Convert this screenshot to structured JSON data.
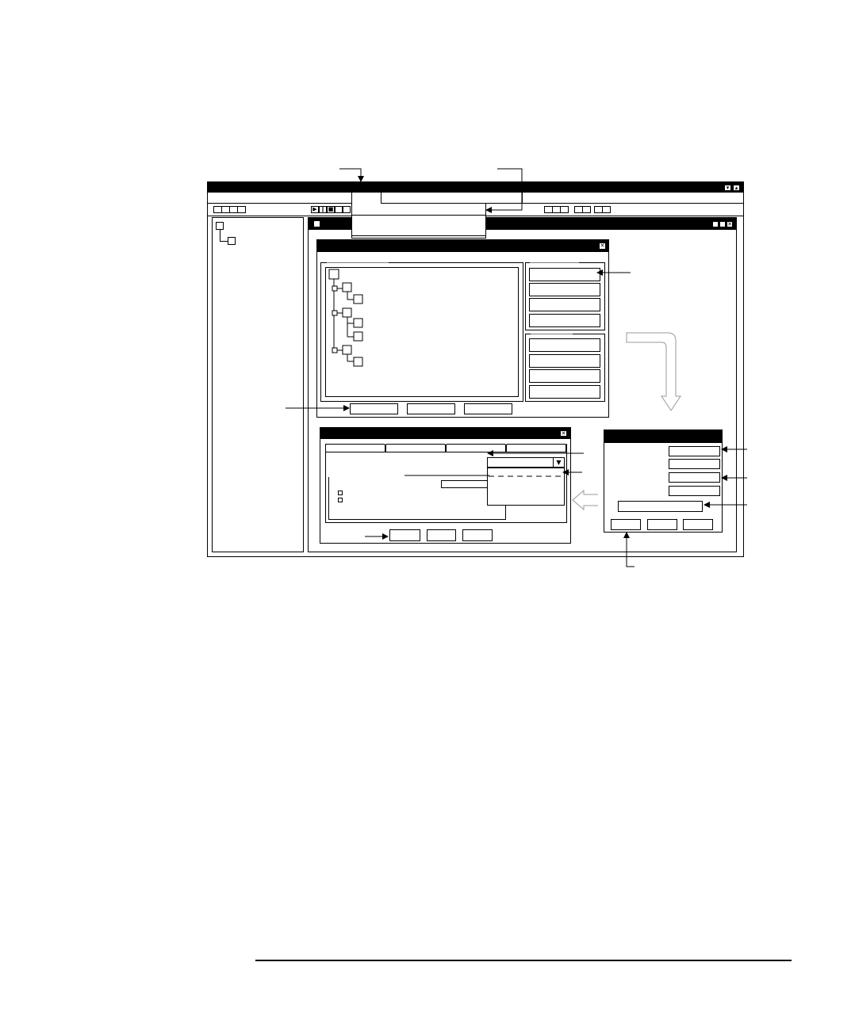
{
  "diagram": {
    "annotations": [],
    "colors": {
      "line": "#000000",
      "background": "#ffffff",
      "flow_arrow": "#9a9a9a"
    }
  },
  "main_window": {
    "title": "",
    "title_controls": [
      "minimize-icon",
      "maximize-icon"
    ],
    "menu_items": [],
    "toolbar_groups": [
      {
        "icons": [
          "toolbar-button",
          "toolbar-button",
          "toolbar-button"
        ]
      },
      {
        "icons": [
          "play-icon",
          "pause-icon",
          "stop-icon",
          "toolbar-button",
          "toolbar-button"
        ]
      },
      {
        "icons": [
          "toolbar-button",
          "toolbar-button",
          "toolbar-button"
        ]
      },
      {
        "icons": [
          "toolbar-button",
          "toolbar-button"
        ]
      },
      {
        "icons": [
          "toolbar-button",
          "toolbar-button"
        ]
      }
    ]
  },
  "sidebar_tree": {
    "nodes": [
      "root-node",
      "child-node"
    ]
  },
  "dropdown_menu": {
    "items": []
  },
  "child_window": {
    "title": "",
    "title_controls": [
      "minimize-icon",
      "maximize-icon",
      "close-icon"
    ]
  },
  "properties_dialog": {
    "title": "",
    "tree_nodes": 10,
    "side_buttons_top": [
      "",
      "",
      "",
      ""
    ],
    "side_buttons_bottom": [
      "",
      "",
      "",
      ""
    ],
    "footer_buttons": [
      "",
      "",
      ""
    ]
  },
  "tab_dialog": {
    "title": "",
    "tabs": [
      "",
      "",
      "",
      ""
    ],
    "combo_value": "",
    "list_items": [],
    "checkboxes": [
      {
        "label": "",
        "checked": true
      },
      {
        "label": "",
        "checked": true
      }
    ],
    "footer_buttons": [
      "",
      "",
      ""
    ]
  },
  "small_dialog": {
    "title": "",
    "fields": [
      "",
      "",
      "",
      ""
    ],
    "wide_field": "",
    "footer_buttons": [
      "",
      "",
      ""
    ]
  },
  "footer": {
    "text": ""
  }
}
